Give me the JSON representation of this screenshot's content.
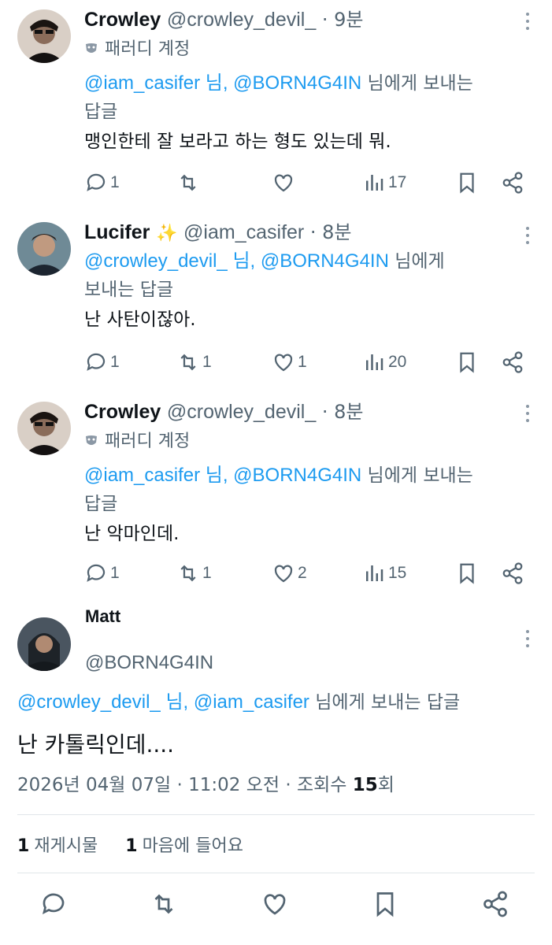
{
  "replies": [
    {
      "name": "Crowley",
      "handle": "@crowley_devil_",
      "time": "· 9분",
      "parody_label": "패러디 계정",
      "replying_mentions": "@iam_casifer 님, @BORN4G4IN",
      "replying_suffix": " 님에게 보내는",
      "replying_suffix2": "답글",
      "text": "맹인한테 잘 보라고 하는 형도 있는데 뭐.",
      "counts": {
        "reply": "1",
        "repost": "",
        "like": "",
        "views": "17"
      }
    },
    {
      "name": "Lucifer",
      "sparkle": "✨",
      "handle": "@iam_casifer",
      "time": "· 8분",
      "replying_mentions": "@crowley_devil_ 님, @BORN4G4IN",
      "replying_suffix": " 님에게",
      "replying_suffix2": "보내는 답글",
      "text": "난 사탄이잖아.",
      "counts": {
        "reply": "1",
        "repost": "1",
        "like": "1",
        "views": "20"
      }
    },
    {
      "name": "Crowley",
      "handle": "@crowley_devil_",
      "time": "· 8분",
      "parody_label": "패러디 계정",
      "replying_mentions": "@iam_casifer 님, @BORN4G4IN",
      "replying_suffix": " 님에게 보내는",
      "replying_suffix2": "답글",
      "text": "난 악마인데.",
      "counts": {
        "reply": "1",
        "repost": "1",
        "like": "2",
        "views": "15"
      }
    }
  ],
  "focus": {
    "name": "Matt",
    "handle": "@BORN4G4IN",
    "replying_mentions": "@crowley_devil_ 님, @iam_casifer",
    "replying_suffix": " 님에게 보내는 답글",
    "text": "난 카톨릭인데....",
    "date": "2026년 04월 07일 · 11:02 오전 · 조회수 ",
    "views": "15",
    "views_suffix": "회",
    "reposts_count": "1",
    "reposts_label": "재게시물",
    "likes_count": "1",
    "likes_label": "마음에 들어요"
  },
  "colors": {
    "link": "#1d9bf0",
    "muted": "#536471",
    "text": "#0f1419"
  }
}
